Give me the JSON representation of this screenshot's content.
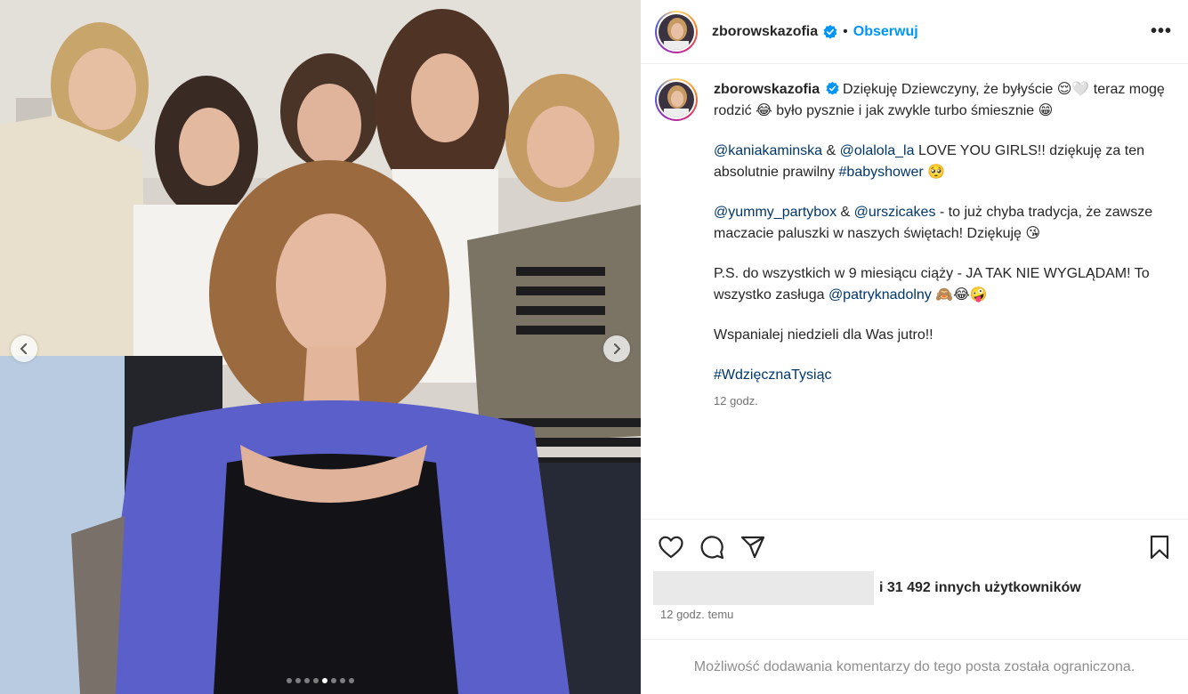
{
  "post": {
    "username": "zborowskazofia",
    "follow_label": "Obserwuj",
    "separator": "•",
    "more_label": "•••"
  },
  "media": {
    "carousel_count": 8,
    "active_index": 4
  },
  "caption": {
    "username": "zborowskazofia",
    "line1_a": "Dziękuję Dziewczyny, że byłyście ",
    "emoji1": "😌🤍",
    "line1_b": " teraz mogę rodzić ",
    "emoji2": "😂",
    "line1_c": " było pysznie i jak zwykle turbo śmiesznie ",
    "emoji3": "😁",
    "mention1": "@kaniakaminska",
    "amp1": " & ",
    "mention2": "@olalola_la",
    "line2_a": " LOVE YOU GIRLS!! dziękuję za ten absolutnie prawilny ",
    "hashtag1": "#babyshower",
    "emoji4": "🥺",
    "mention3": "@yummy_partybox",
    "amp2": " & ",
    "mention4": "@urszicakes",
    "line3_a": " - to już chyba tradycja, że zawsze maczacie paluszki w naszych świętach! Dziękuję ",
    "emoji5": "😘",
    "line4_a": "P.S. do wszystkich w 9 miesiącu ciąży - JA TAK NIE WYGLĄDAM! To wszystko zasługa ",
    "mention5": "@patryknadolny",
    "emoji6": "🙈😂🤪",
    "line5": "Wspanialej niedzieli dla Was jutro!!",
    "hashtag2": "#WdzięcznaTysiąc",
    "time": "12 godz."
  },
  "actions": {
    "like_icon": "heart-icon",
    "comment_icon": "comment-icon",
    "share_icon": "paper-plane-icon",
    "save_icon": "bookmark-icon",
    "likes_text": "i 31 492 innych użytkowników",
    "posted_time": "12 godz. temu"
  },
  "comments_notice": "Możliwość dodawania komentarzy do tego posta została ograniczona.",
  "colors": {
    "follow": "#0095f6",
    "mention": "#00376b",
    "verified": "#0095f6"
  }
}
